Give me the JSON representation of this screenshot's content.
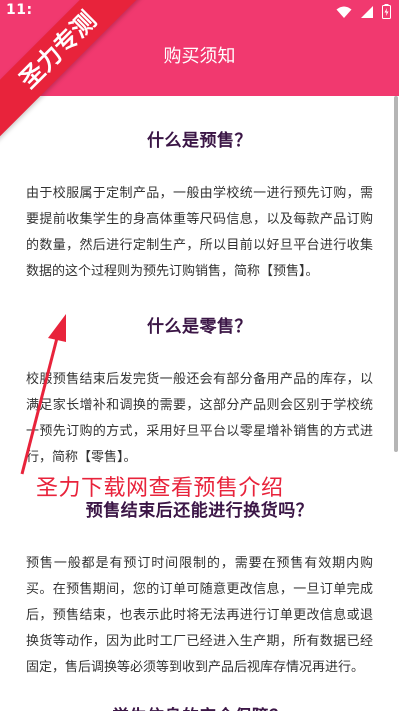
{
  "status_bar": {
    "time": "11:"
  },
  "watermark": {
    "ribbon": "圣力专测",
    "overlay": "圣力下载网查看预售介绍"
  },
  "header": {
    "title": "购买须知"
  },
  "sections": [
    {
      "title": "什么是预售？",
      "body": "由于校服属于定制产品，一般由学校统一进行预先订购，需要提前收集学生的身高体重等尺码信息，以及每款产品订购的数量，然后进行定制生产，所以目前以好旦平台进行收集数据的这个过程则为预先订购销售，简称【预售】。"
    },
    {
      "title": "什么是零售？",
      "body": "校服预售结束后发完货一般还会有部分备用产品的库存，以满足家长增补和调换的需要，这部分产品则会区别于学校统一预先订购的方式，采用好旦平台以零星增补销售的方式进行，简称【零售】。"
    },
    {
      "title": "预售结束后还能进行换货吗？",
      "body": "预售一般都是有预订时间限制的，需要在预售有效期内购买。在预售期间，您的订单可随意更改信息，一旦订单完成后，预售结束，也表示此时将无法再进行订单更改信息或退换货等动作，因为此时工厂已经进入生产期，所有数据已经固定，售后调换等必须等到收到产品后视库存情况再进行。"
    },
    {
      "title": "学生信息的安全保障？"
    }
  ]
}
